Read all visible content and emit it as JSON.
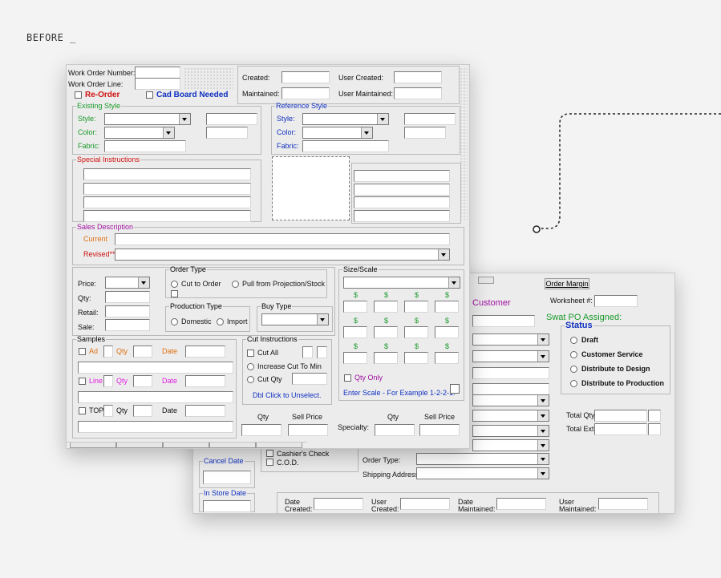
{
  "caption": "BEFORE _",
  "colors": {
    "green": "#1a9a2a",
    "red": "#d01010",
    "blue": "#1030c0",
    "purple": "#a010a0",
    "orange": "#e07010",
    "magenta": "#e020e0"
  },
  "back": {
    "tabs": {
      "order_margin": "Order Margin"
    },
    "worksheet_label": "Worksheet #:",
    "customer": "Customer",
    "swat_po": "Swat PO Assigned:",
    "status": {
      "title": "Status",
      "options": [
        "Draft",
        "Customer Service",
        "Distribute to Design",
        "Distribute to Production"
      ]
    },
    "total_qty": "Total Qty:",
    "total_ext": "Total Ext:",
    "cashiers_check": "Cashier's Check",
    "cod": "C.O.D.",
    "cancel_date": "Cancel Date",
    "in_store_date": "In Store Date",
    "order_type": "Order Type:",
    "shipping_address": "Shipping Address:",
    "footer": {
      "date_created": "Date\nCreated:",
      "user_created": "User\nCreated:",
      "date_maintained": "Date\nMaintained:",
      "user_maintained": "User\nMaintained:"
    }
  },
  "front": {
    "work_order_number": "Work Order Number:",
    "work_order_line": "Work Order Line:",
    "re_order": "Re-Order",
    "cad_board_needed": "Cad Board Needed",
    "created": "Created:",
    "user_created": "User Created:",
    "maintained": "Maintained:",
    "user_maintained": "User Maintained:",
    "existing_style": {
      "title": "Existing Style",
      "style": "Style:",
      "color": "Color:",
      "fabric": "Fabric:"
    },
    "reference_style": {
      "title": "Reference Style",
      "style": "Style:",
      "color": "Color:",
      "fabric": "Fabric:"
    },
    "special_instructions": "Special Instructions",
    "sales_description": {
      "title": "Sales Description",
      "current": "Current",
      "revised": "Revised**"
    },
    "price": "Price:",
    "qty": "Qty:",
    "retail": "Retail:",
    "sale": "Sale:",
    "order_type": {
      "title": "Order Type",
      "cut_to_order": "Cut to Order",
      "pull_from_projection": "Pull from Projection/Stock"
    },
    "production_type": {
      "title": "Production Type",
      "domestic": "Domestic",
      "import": "Import"
    },
    "buy_type": "Buy Type",
    "size_scale": "Size/Scale",
    "dollar": "$",
    "qty_only": "Qty Only",
    "enter_scale": "Enter Scale - For Example 1-2-2-1.",
    "samples": {
      "title": "Samples",
      "ad": "Ad",
      "qty": "Qty",
      "date": "Date",
      "line": "Line",
      "top": "TOP"
    },
    "cut_instructions": {
      "title": "Cut Instructions",
      "cut_all": "Cut All",
      "increase": "Increase Cut To Min",
      "cut_qty": "Cut Qty",
      "dbl_click": "Dbl Click to Unselect."
    },
    "bottom_qty": "Qty",
    "bottom_sell_price": "Sell Price",
    "specialty": "Specialty:",
    "specialty_qty": "Qty",
    "specialty_sell_price": "Sell Price"
  }
}
